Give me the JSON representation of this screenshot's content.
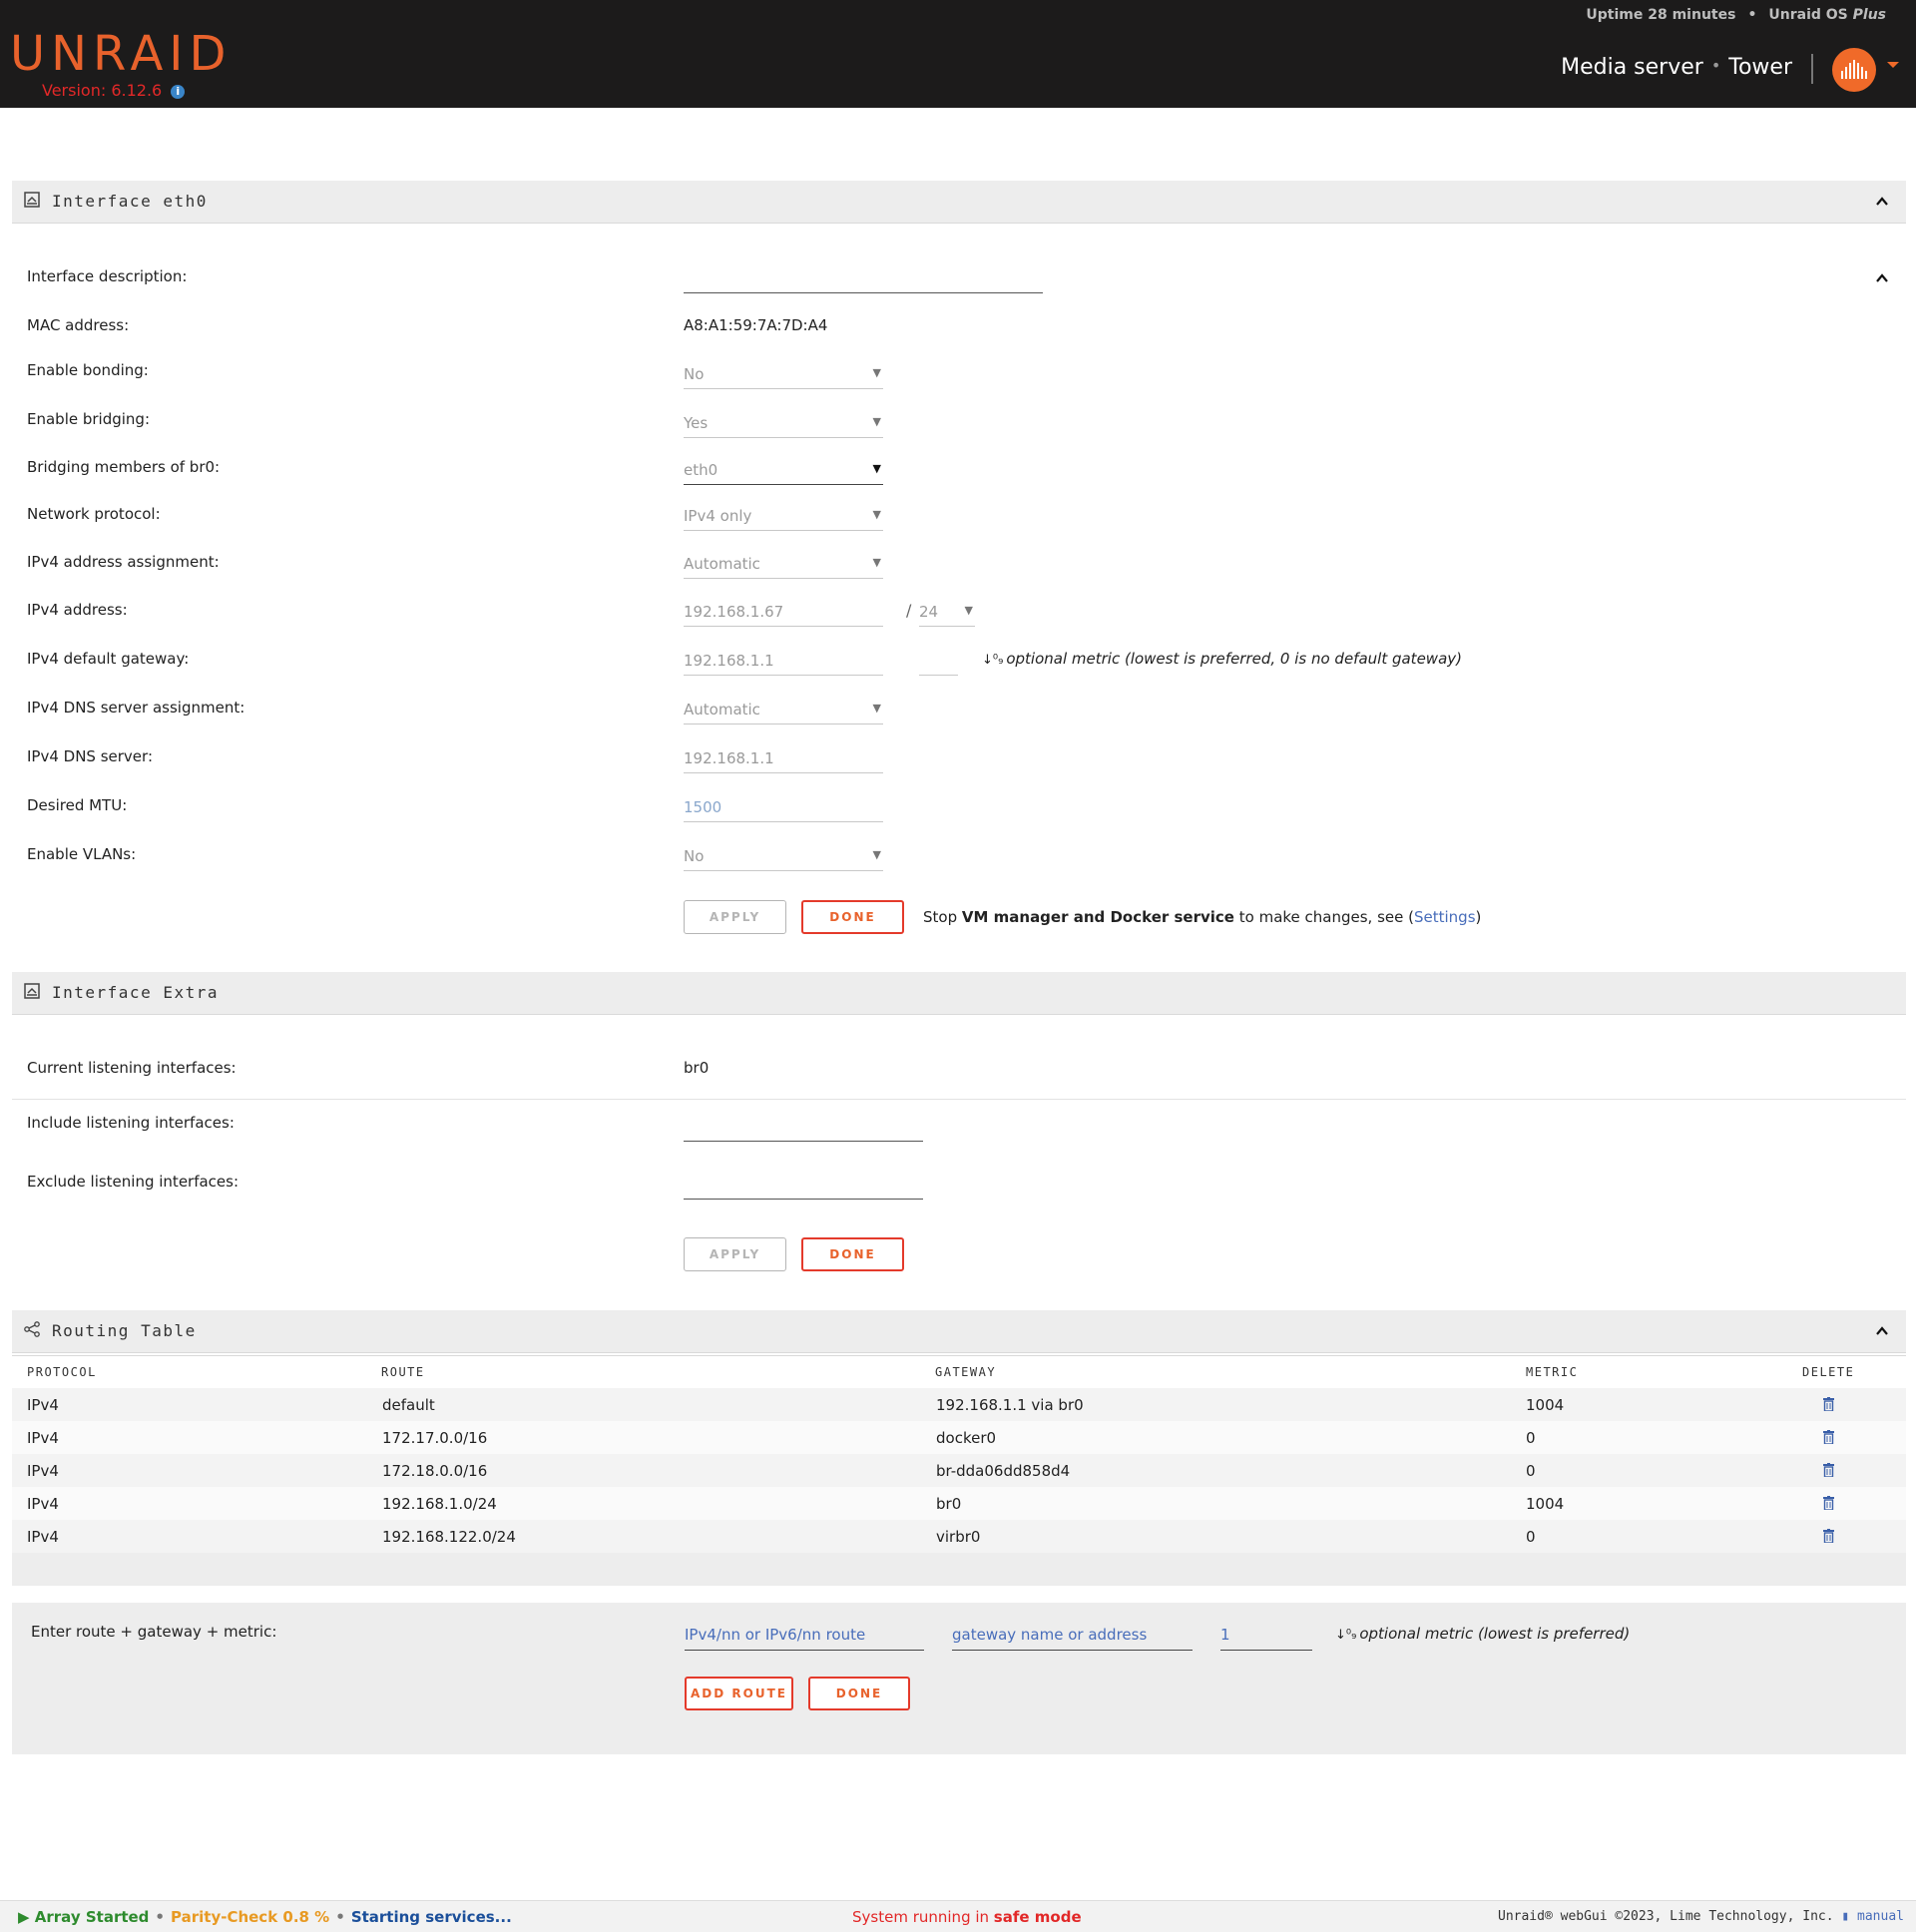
{
  "header": {
    "logo": "UNRAID",
    "version": "Version: 6.12.6",
    "uptime": "Uptime 28 minutes",
    "os": "Unraid OS",
    "os_edition": "Plus",
    "server_description": "Media server",
    "server_name": "Tower"
  },
  "interface_eth0": {
    "title": "Interface eth0",
    "rows": {
      "description_label": "Interface description:",
      "mac_label": "MAC address:",
      "mac_value": "A8:A1:59:7A:7D:A4",
      "bonding_label": "Enable bonding:",
      "bonding_value": "No",
      "bridging_label": "Enable bridging:",
      "bridging_value": "Yes",
      "bridge_members_label": "Bridging members of br0:",
      "bridge_members_value": "eth0",
      "protocol_label": "Network protocol:",
      "protocol_value": "IPv4 only",
      "ipv4_assign_label": "IPv4 address assignment:",
      "ipv4_assign_value": "Automatic",
      "ipv4_address_label": "IPv4 address:",
      "ipv4_address_value": "192.168.1.67",
      "ipv4_netmask_sep": "/",
      "ipv4_netmask_value": "24",
      "ipv4_gateway_label": "IPv4 default gateway:",
      "ipv4_gateway_value": "192.168.1.1",
      "ipv4_gateway_hint": "optional metric (lowest is preferred, 0 is no default gateway)",
      "dns_assign_label": "IPv4 DNS server assignment:",
      "dns_assign_value": "Automatic",
      "dns_server_label": "IPv4 DNS server:",
      "dns_server_value": "192.168.1.1",
      "mtu_label": "Desired MTU:",
      "mtu_placeholder": "1500",
      "vlans_label": "Enable VLANs:",
      "vlans_value": "No"
    },
    "apply_label": "APPLY",
    "done_label": "DONE",
    "notice_pre": "Stop ",
    "notice_bold": "VM manager and Docker service",
    "notice_mid": " to make changes, see (",
    "notice_link": "Settings",
    "notice_post": ")"
  },
  "interface_extra": {
    "title": "Interface Extra",
    "current_label": "Current listening interfaces:",
    "current_value": "br0",
    "include_label": "Include listening interfaces:",
    "exclude_label": "Exclude listening interfaces:",
    "apply_label": "APPLY",
    "done_label": "DONE"
  },
  "routing_table": {
    "title": "Routing Table",
    "columns": [
      "PROTOCOL",
      "ROUTE",
      "GATEWAY",
      "METRIC",
      "DELETE"
    ],
    "rows": [
      {
        "protocol": "IPv4",
        "route": "default",
        "gateway": "192.168.1.1 via br0",
        "metric": "1004"
      },
      {
        "protocol": "IPv4",
        "route": "172.17.0.0/16",
        "gateway": "docker0",
        "metric": "0"
      },
      {
        "protocol": "IPv4",
        "route": "172.18.0.0/16",
        "gateway": "br-dda06dd858d4",
        "metric": "0"
      },
      {
        "protocol": "IPv4",
        "route": "192.168.1.0/24",
        "gateway": "br0",
        "metric": "1004"
      },
      {
        "protocol": "IPv4",
        "route": "192.168.122.0/24",
        "gateway": "virbr0",
        "metric": "0"
      }
    ]
  },
  "add_route": {
    "label": "Enter route + gateway + metric:",
    "route_placeholder": "IPv4/nn or IPv6/nn route",
    "gateway_placeholder": "gateway name or address",
    "metric_value": "1",
    "hint": "optional metric (lowest is preferred)",
    "add_label": "ADD ROUTE",
    "done_label": "DONE"
  },
  "footer": {
    "array_status": "Array Started",
    "parity": "Parity-Check 0.8 %",
    "services": "Starting services...",
    "safe_mode_pre": "System running in ",
    "safe_mode_bold": "safe mode",
    "copyright": "Unraid® webGui ©2023, Lime Technology, Inc.",
    "manual_link": "manual"
  },
  "colors": {
    "accent_orange": "#e8622c",
    "header_bg": "#1c1b1b",
    "danger_red": "#e22828",
    "link_blue": "#486dba"
  },
  "icons": [
    "info-icon",
    "avatar-icon",
    "chevron-up-icon",
    "network-icon",
    "share-icon",
    "trash-icon",
    "sort-icon",
    "book-icon",
    "play-icon"
  ]
}
